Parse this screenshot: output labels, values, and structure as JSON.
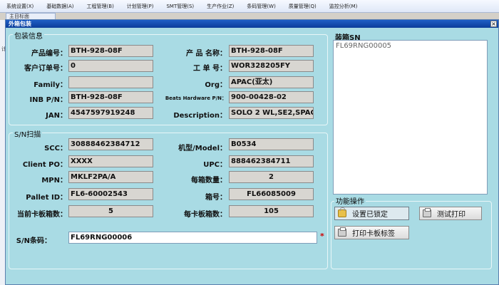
{
  "menu": [
    "系统设置(X)",
    "基础数据(A)",
    "工程管理(B)",
    "计划管理(P)",
    "SMT管理(S)",
    "生产作业(Z)",
    "条码管理(W)",
    "质量管理(Q)",
    "监控分析(M)"
  ],
  "sub_tab": "主目标面",
  "left_strip_text": "计",
  "dialog": {
    "title": "外箱包装",
    "close": "×"
  },
  "pack_info": {
    "legend": "包装信息",
    "product_no_label": "产品编号：",
    "product_no": "BTH-928-08F",
    "product_name_label": "产 品 名称：",
    "product_name": "BTH-928-08F",
    "customer_po_label": "客户订单号：",
    "customer_po": "0",
    "work_order_label": "工 单 号：",
    "work_order": "WOR328205FY",
    "family_label": "Family：",
    "family": "",
    "org_label": "Org：",
    "org": "APAC(亚太)",
    "inb_pn_label": "INB P/N：",
    "inb_pn": "BTH-928-08F",
    "beats_hw_label": "Beats Hardware P/N：",
    "beats_hw": "900-00428-02",
    "jan_label": "JAN：",
    "jan": "4547597919248",
    "description_label": "Description：",
    "description": "SOLO 2 WL,SE2,SPAC"
  },
  "sn_scan": {
    "legend": "S/N扫描",
    "scc_label": "SCC：",
    "scc": "30888462384712",
    "model_label": "机型/Model：",
    "model": "B0534",
    "client_po_label": "Client PO：",
    "client_po": "XXXX",
    "upc_label": "UPC：",
    "upc": "888462384711",
    "mpn_label": "MPN：",
    "mpn": "MKLF2PA/A",
    "per_box_label": "每箱数量：",
    "per_box": "2",
    "pallet_label": "Pallet ID：",
    "pallet": "FL6-60002543",
    "box_no_label": "箱号：",
    "box_no": "FL66085009",
    "current_pallet_label": "当前卡板箱数：",
    "current_pallet": "5",
    "per_pallet_label": "每卡板箱数：",
    "per_pallet": "105",
    "sn_input_label": "S/N条码：",
    "sn_input": "FL69RNG00006",
    "required_mark": "*"
  },
  "packed_sn": {
    "legend": "装箱SN",
    "items": [
      "FL69RNG00005"
    ]
  },
  "actions": {
    "legend": "功能操作",
    "lock_label": "设置已锁定",
    "test_print_label": "测试打印",
    "print_pallet_label": "打印卡板标签"
  }
}
